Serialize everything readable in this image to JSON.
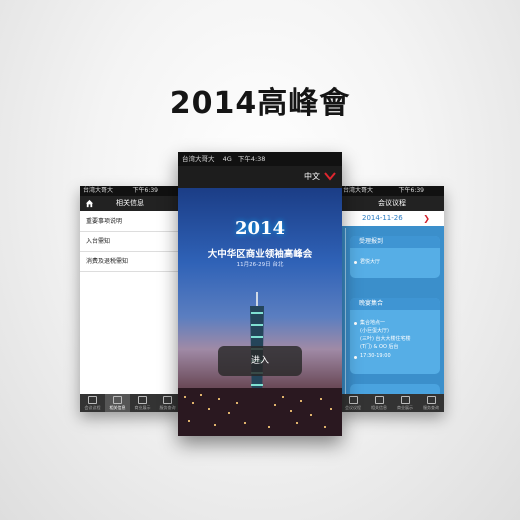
{
  "headline": "2014高峰會",
  "left_screen": {
    "status": {
      "carrier": "台湾大哥大",
      "time": "下午6:39"
    },
    "nav_title": "相关信息",
    "list_items": [
      "重要事项说明",
      "入台需知",
      "消费及退税需知"
    ],
    "tabs": [
      "会议议程",
      "相关信息",
      "商业展示",
      "服务查询"
    ]
  },
  "center_screen": {
    "status": {
      "carrier": "台湾大哥大",
      "network": "4G",
      "time": "下午4:38"
    },
    "language": "中文",
    "logo": "2014",
    "event_title": "大中华区商业领袖高峰会",
    "event_dates": "11月26-29日 台北",
    "enter_label": "进入"
  },
  "right_screen": {
    "status": {
      "carrier": "台湾大哥大",
      "time": "下午6:39"
    },
    "nav_title": "会议议程",
    "date": "2014-11-26",
    "cards": [
      {
        "title": "受理报到",
        "lines": [
          "君悦大厅"
        ]
      },
      {
        "title": "晚宴集合",
        "lines": [
          "集合地点一",
          "(小巨蛋大厅)",
          "(三叶) 台大大楼住宅楼",
          "(T门) & OO 后台",
          "17:30-19:00"
        ]
      }
    ],
    "tabs": [
      "会议议程",
      "相关信息",
      "商业展示",
      "服务查询"
    ]
  },
  "colors": {
    "accent_red": "#d21f2b",
    "agenda_blue": "#3b8fcb"
  }
}
